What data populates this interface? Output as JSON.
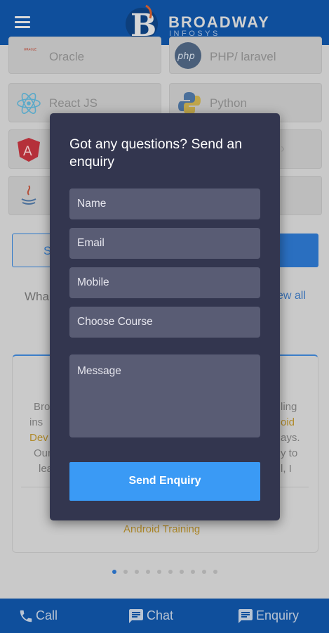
{
  "header": {
    "brand_name": "BROADWAY",
    "brand_sub": "INFOSYS"
  },
  "courses": [
    {
      "label": "Oracle",
      "icon": "oracle-logo"
    },
    {
      "label": "PHP/ laravel",
      "icon": "php-logo"
    },
    {
      "label": "React JS",
      "icon": "react-logo"
    },
    {
      "label": "Python",
      "icon": "python-logo"
    },
    {
      "label": "",
      "icon": "angular-logo"
    },
    {
      "label": "",
      "icon": "java-logo"
    }
  ],
  "page": {
    "what_text": "Wha",
    "view_all": "ew all",
    "button_outline_fragment": "S"
  },
  "testimonial": {
    "lines_left": [
      "Bro",
      "ins",
      "Dev",
      "Our",
      "lea"
    ],
    "lines_right": [
      "ling",
      "oid",
      "ays.",
      "y to",
      "l, I"
    ],
    "course": "Android Training"
  },
  "modal": {
    "title": "Got any questions? Send an enquiry",
    "fields": {
      "name": "Name",
      "email": "Email",
      "mobile": "Mobile",
      "course": "Choose Course",
      "message": "Message"
    },
    "submit_label": "Send Enquiry"
  },
  "bottom_nav": {
    "call": "Call",
    "chat": "Chat",
    "enquiry": "Enquiry"
  },
  "carousel": {
    "total": 10,
    "active_index": 0
  },
  "colors": {
    "header_bg": "#0f4f9c",
    "modal_bg": "#33364f",
    "field_bg": "#595c74",
    "send_button": "#3a9af5"
  }
}
